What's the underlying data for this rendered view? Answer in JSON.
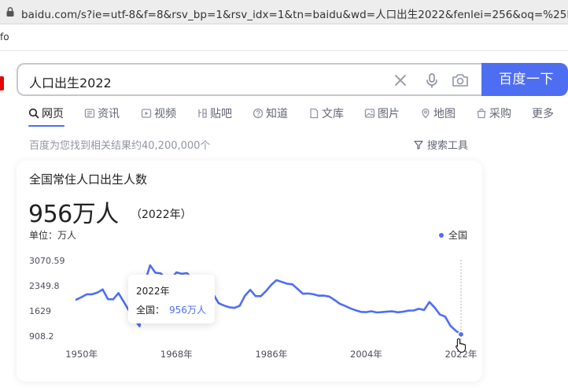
{
  "browser": {
    "url": "baidu.com/s?ie=utf-8&f=8&rsv_bp=1&rsv_idx=1&tn=baidu&wd=人口出生2022&fenlei=256&oq=%25E4%",
    "bookmark_fragment": "fo"
  },
  "search": {
    "query": "人口出生2022",
    "button_label": "百度一下"
  },
  "tabs": [
    {
      "label": "网页",
      "icon": "search-icon",
      "active": true
    },
    {
      "label": "资讯",
      "icon": "news-icon"
    },
    {
      "label": "视频",
      "icon": "video-icon"
    },
    {
      "label": "贴吧",
      "icon": "tieba-icon"
    },
    {
      "label": "知道",
      "icon": "question-icon"
    },
    {
      "label": "文库",
      "icon": "doc-icon"
    },
    {
      "label": "图片",
      "icon": "image-icon"
    },
    {
      "label": "地图",
      "icon": "map-icon"
    },
    {
      "label": "采购",
      "icon": "bag-icon"
    },
    {
      "label": "更多"
    }
  ],
  "results": {
    "count_text": "百度为您找到相关结果约40,200,000个",
    "tools_label": "搜索工具"
  },
  "card": {
    "title": "全国常住人口出生人数",
    "value": "956万人",
    "year": "（2022年）",
    "unit_label": "单位：万人",
    "legend": "全国",
    "accent_color": "#4e6ef2"
  },
  "tooltip": {
    "year": "2022年",
    "label": "全国：",
    "value": "956万人"
  },
  "chart_data": {
    "type": "line",
    "series": [
      {
        "name": "全国",
        "x": [
          1949,
          1950,
          1951,
          1952,
          1953,
          1954,
          1955,
          1956,
          1957,
          1958,
          1959,
          1960,
          1961,
          1962,
          1963,
          1964,
          1965,
          1966,
          1967,
          1968,
          1969,
          1970,
          1971,
          1972,
          1973,
          1974,
          1975,
          1976,
          1977,
          1978,
          1979,
          1980,
          1981,
          1982,
          1983,
          1984,
          1985,
          1986,
          1987,
          1988,
          1989,
          1990,
          1991,
          1992,
          1993,
          1994,
          1995,
          1996,
          1997,
          1998,
          1999,
          2000,
          2001,
          2002,
          2003,
          2004,
          2005,
          2006,
          2007,
          2008,
          2009,
          2010,
          2011,
          2012,
          2013,
          2014,
          2015,
          2016,
          2017,
          2018,
          2019,
          2020,
          2021,
          2022
        ],
        "values": [
          1950,
          2023,
          2105,
          2105,
          2151,
          2245,
          1965,
          1961,
          2138,
          1889,
          1635,
          1389,
          1187,
          2451,
          2934,
          2721,
          2704,
          2554,
          2543,
          2731,
          2690,
          2710,
          2551,
          2550,
          2447,
          2226,
          2102,
          1849,
          1783,
          1733,
          1715,
          1776,
          2064,
          2230,
          2052,
          2050,
          2196,
          2374,
          2508,
          2457,
          2407,
          2391,
          2258,
          2119,
          2126,
          2104,
          2063,
          2067,
          2038,
          1942,
          1834,
          1771,
          1702,
          1647,
          1599,
          1593,
          1617,
          1584,
          1594,
          1608,
          1615,
          1588,
          1604,
          1635,
          1640,
          1687,
          1655,
          1883,
          1723,
          1523,
          1465,
          1202,
          1062,
          956
        ]
      }
    ],
    "yticks": [
      "3070.59",
      "2349.8",
      "1629",
      "908.2"
    ],
    "ytick_values": [
      3070.59,
      2349.8,
      1629,
      908.2
    ],
    "xticks": [
      "1950年",
      "1968年",
      "1986年",
      "2004年",
      "2022年"
    ],
    "xtick_values": [
      1950,
      1968,
      1986,
      2004,
      2022
    ],
    "xlim": [
      1949,
      2022
    ],
    "highlight_x": 2022,
    "grid": false,
    "legend_position": "top-right"
  }
}
